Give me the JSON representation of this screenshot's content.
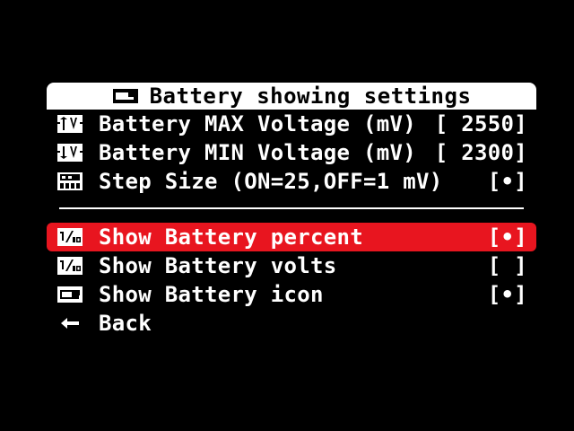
{
  "title": {
    "icon": "battery-icon",
    "text": "Battery showing settings"
  },
  "settings": [
    {
      "icon": "voltage-up-icon",
      "label": "Battery MAX Voltage (mV)",
      "value": "[ 2550]"
    },
    {
      "icon": "voltage-down-icon",
      "label": "Battery MIN Voltage (mV)",
      "value": "[ 2300]"
    },
    {
      "icon": "step-size-icon",
      "label": "Step Size (ON=25,OFF=1 mV)",
      "value": "[•]"
    }
  ],
  "display": [
    {
      "icon": "percent-icon",
      "label": "Show Battery percent",
      "value": "[•]",
      "selected": true
    },
    {
      "icon": "volts-icon",
      "label": "Show Battery volts",
      "value": "[ ]",
      "selected": false
    },
    {
      "icon": "battery-icon",
      "label": "Show Battery icon",
      "value": "[•]",
      "selected": false
    }
  ],
  "back": {
    "icon": "back-arrow-icon",
    "label": "Back"
  },
  "colors": {
    "background": "#000000",
    "text": "#ffffff",
    "highlight": "#e8151f",
    "title_bg": "#ffffff"
  }
}
